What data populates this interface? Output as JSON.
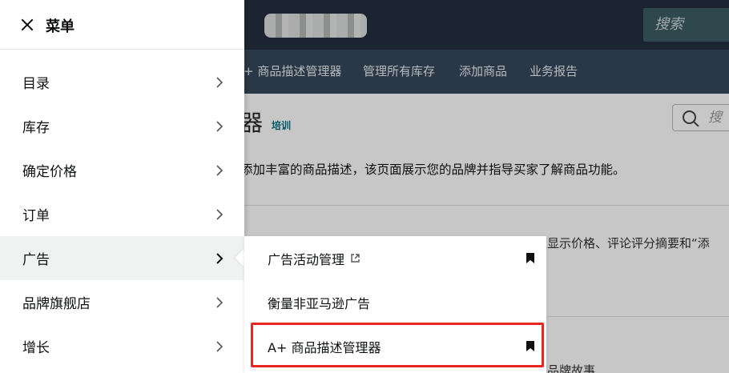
{
  "background": {
    "search_placeholder": "搜索",
    "nav_items": [
      "+ 商品描述管理器",
      "管理所有库存",
      "添加商品",
      "业务报告"
    ],
    "page_title_fragment": "器",
    "training_link": "培训",
    "page_search_placeholder": "搜",
    "description": "添加丰富的商品描述，该页面展示您的品牌并指导买家了解商品功能。",
    "description2": "显示价格、评论评分摘要和“添",
    "cut_text": "品牌故事"
  },
  "menu": {
    "title": "菜单",
    "items": [
      {
        "label": "目录"
      },
      {
        "label": "库存"
      },
      {
        "label": "确定价格"
      },
      {
        "label": "订单"
      },
      {
        "label": "广告"
      },
      {
        "label": "品牌旗舰店"
      },
      {
        "label": "增长"
      }
    ],
    "active_item": "广告"
  },
  "submenu": {
    "items": [
      {
        "label": "广告活动管理",
        "external": true,
        "bookmarked": true
      },
      {
        "label": "衡量非亚马逊广告",
        "external": false,
        "bookmarked": false
      },
      {
        "label": "A+ 商品描述管理器",
        "external": false,
        "bookmarked": true
      }
    ],
    "highlighted_item": "A+ 商品描述管理器"
  },
  "colors": {
    "topbar": "#232f3e",
    "navbar": "#37475a",
    "highlight_border": "#e8261f",
    "active_bg": "#f0f2f2"
  }
}
